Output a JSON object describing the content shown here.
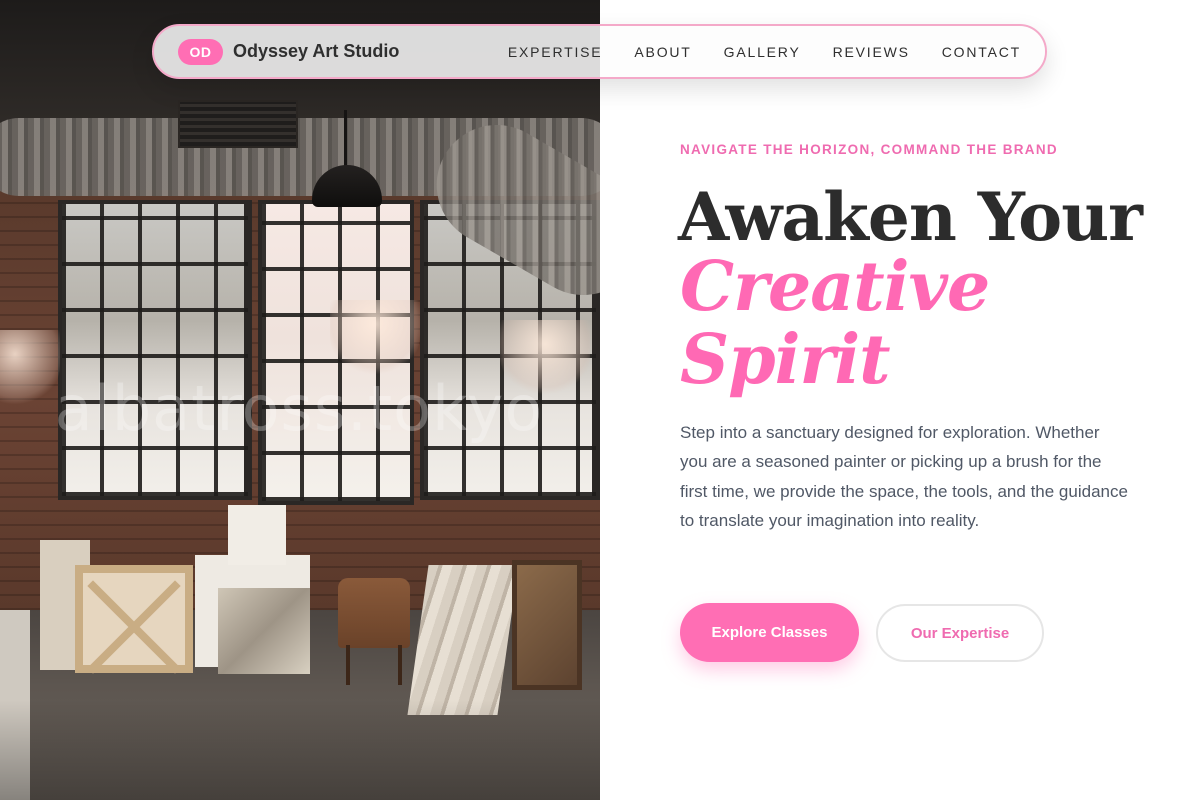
{
  "photo": {
    "watermark": "albatross.tokyo"
  },
  "nav": {
    "logo_badge": "OD",
    "brand_name": "Odyssey Art Studio",
    "items": [
      {
        "label": "EXPERTISE"
      },
      {
        "label": "ABOUT"
      },
      {
        "label": "GALLERY"
      },
      {
        "label": "REVIEWS"
      },
      {
        "label": "CONTACT"
      }
    ]
  },
  "hero": {
    "eyebrow": "NAVIGATE THE HORIZON, COMMAND THE BRAND",
    "title_line1": "Awaken Your",
    "title_line2": "Creative",
    "title_line3": "Spirit",
    "body": "Step into a sanctuary designed for exploration. Whether you are a seasoned painter or picking up a brush for the first time, we provide the space, the tools, and the guidance to translate your imagination into reality.",
    "primary_button": "Explore Classes",
    "secondary_button": "Our Expertise"
  },
  "colors": {
    "accent_pink": "#ff6eb4",
    "text_dark": "#2c2c2c",
    "body_gray": "#505866"
  }
}
